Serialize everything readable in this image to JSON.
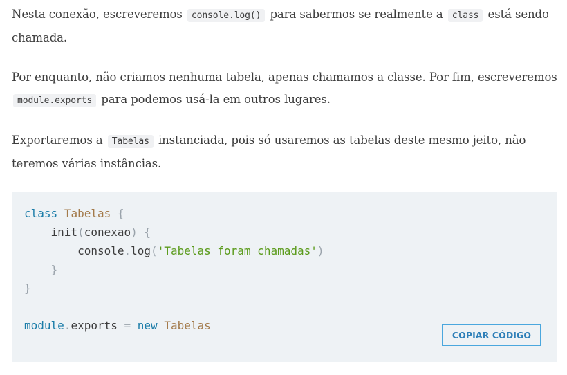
{
  "paragraphs": [
    {
      "parts": [
        {
          "t": "Nesta conexão, escreveremos "
        },
        {
          "code": "console.log()"
        },
        {
          "t": " para sabermos se realmente a "
        },
        {
          "code": "class"
        },
        {
          "t": " está sendo chamada."
        }
      ]
    },
    {
      "parts": [
        {
          "t": "Por enquanto, não criamos nenhuma tabela, apenas chamamos a classe. Por fim, escreveremos "
        },
        {
          "code": "module.exports"
        },
        {
          "t": " para podemos usá-la em outros lugares."
        }
      ]
    },
    {
      "parts": [
        {
          "t": "Exportaremos a "
        },
        {
          "code": "Tabelas"
        },
        {
          "t": " instanciada, pois só usaremos as tabelas deste mesmo jeito, não teremos várias instâncias."
        }
      ]
    }
  ],
  "code_block": {
    "lines": [
      [
        {
          "k": "kw",
          "t": "class"
        },
        {
          "k": "plain",
          "t": " "
        },
        {
          "k": "cls",
          "t": "Tabelas"
        },
        {
          "k": "plain",
          "t": " "
        },
        {
          "k": "punc",
          "t": "{"
        }
      ],
      [
        {
          "k": "plain",
          "t": "    init"
        },
        {
          "k": "punc",
          "t": "("
        },
        {
          "k": "plain",
          "t": "conexao"
        },
        {
          "k": "punc",
          "t": ")"
        },
        {
          "k": "plain",
          "t": " "
        },
        {
          "k": "punc",
          "t": "{"
        }
      ],
      [
        {
          "k": "plain",
          "t": "        console"
        },
        {
          "k": "punc",
          "t": "."
        },
        {
          "k": "plain",
          "t": "log"
        },
        {
          "k": "punc",
          "t": "("
        },
        {
          "k": "str",
          "t": "'Tabelas foram chamadas'"
        },
        {
          "k": "punc",
          "t": ")"
        }
      ],
      [
        {
          "k": "plain",
          "t": "    "
        },
        {
          "k": "punc",
          "t": "}"
        }
      ],
      [
        {
          "k": "punc",
          "t": "}"
        }
      ],
      [],
      [
        {
          "k": "kw",
          "t": "module"
        },
        {
          "k": "punc",
          "t": "."
        },
        {
          "k": "plain",
          "t": "exports "
        },
        {
          "k": "punc",
          "t": "="
        },
        {
          "k": "plain",
          "t": " "
        },
        {
          "k": "kw",
          "t": "new"
        },
        {
          "k": "plain",
          "t": " "
        },
        {
          "k": "cls",
          "t": "Tabelas"
        }
      ]
    ],
    "copy_label": "COPIAR CÓDIGO"
  },
  "colors": {
    "keyword": "#1a7ca8",
    "class_name": "#a37a4a",
    "string": "#5b9b1c",
    "punctuation": "#9aa3ab",
    "code_bg": "#eef2f5",
    "button_border": "#4aa7de",
    "button_text": "#2e7fb8"
  }
}
